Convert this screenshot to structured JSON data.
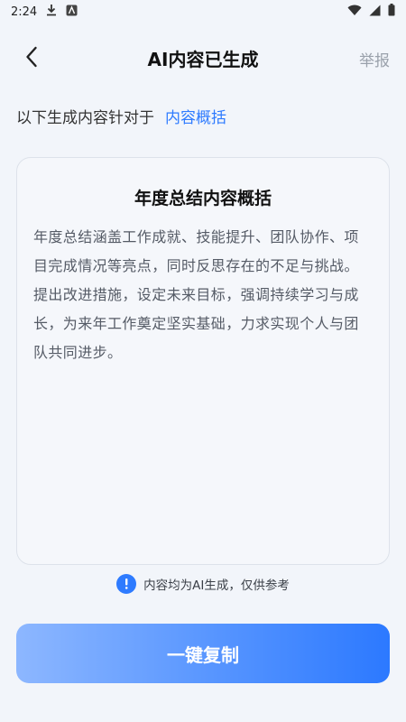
{
  "status_bar": {
    "time": "2:24",
    "icons": [
      "download-icon",
      "app-notification-icon",
      "wifi-icon",
      "signal-icon",
      "battery-icon"
    ]
  },
  "header": {
    "title": "AI内容已生成",
    "report_label": "举报"
  },
  "subject": {
    "prefix": "以下生成内容针对于",
    "link_text": "内容概括"
  },
  "content_card": {
    "title": "年度总结内容概括",
    "body": "年度总结涵盖工作成就、技能提升、团队协作、项目完成情况等亮点，同时反思存在的不足与挑战。提出改进措施，设定未来目标，强调持续学习与成长，为来年工作奠定坚实基础，力求实现个人与团队共同进步。"
  },
  "notice": {
    "text": "内容均为AI生成，仅供参考"
  },
  "actions": {
    "copy_label": "一键复制"
  },
  "colors": {
    "accent": "#2E7BFF",
    "background": "#F2F5FA"
  }
}
